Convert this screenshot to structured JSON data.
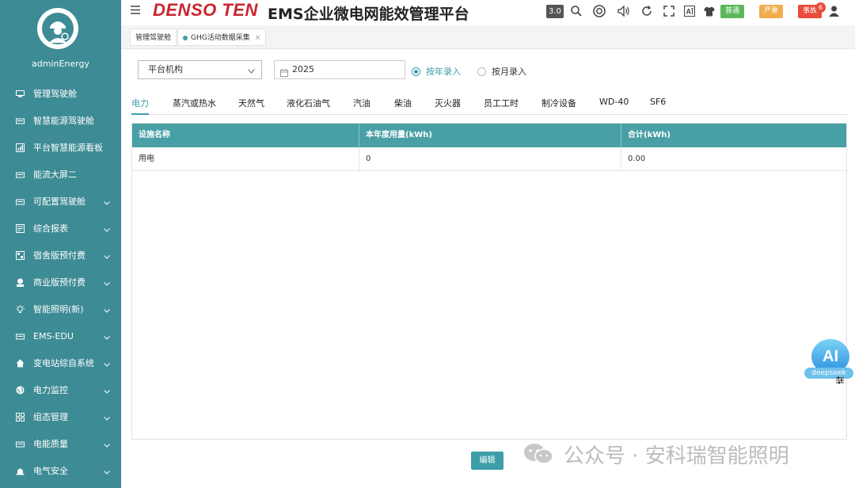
{
  "sidebar": {
    "username": "adminEnergy",
    "items": [
      {
        "label": "管理驾驶舱",
        "icon": "monitor-icon",
        "expandable": false
      },
      {
        "label": "智慧能源驾驶舱",
        "icon": "dashboard-icon",
        "expandable": false
      },
      {
        "label": "平台智慧能源看板",
        "icon": "chart-board-icon",
        "expandable": false
      },
      {
        "label": "能流大屏二",
        "icon": "screen-icon",
        "expandable": false
      },
      {
        "label": "可配置驾驶舱",
        "icon": "config-cockpit-icon",
        "expandable": true
      },
      {
        "label": "综合报表",
        "icon": "report-icon",
        "expandable": true
      },
      {
        "label": "宿舍版预付费",
        "icon": "dorm-icon",
        "expandable": true
      },
      {
        "label": "商业版预付费",
        "icon": "commerce-icon",
        "expandable": true
      },
      {
        "label": "智能照明(新)",
        "icon": "bulb-icon",
        "expandable": true
      },
      {
        "label": "EMS-EDU",
        "icon": "edu-icon",
        "expandable": true
      },
      {
        "label": "变电站综自系统",
        "icon": "home-icon",
        "expandable": true
      },
      {
        "label": "电力监控",
        "icon": "globe-icon",
        "expandable": true
      },
      {
        "label": "组态管理",
        "icon": "grid-icon",
        "expandable": true
      },
      {
        "label": "电能质量",
        "icon": "quality-icon",
        "expandable": true
      },
      {
        "label": "电气安全",
        "icon": "alarm-icon",
        "expandable": true
      }
    ]
  },
  "header": {
    "brand": "DENSO TEN",
    "title": "EMS企业微电网能效管理平台",
    "version": "3.0",
    "badges": [
      {
        "label": "普通",
        "color": "#5cb85c"
      },
      {
        "label": "严重",
        "color": "#f0ad4e"
      },
      {
        "label": "事故",
        "color": "#e74c3c",
        "count": "6"
      }
    ]
  },
  "tabs": {
    "home": "管理驾驶舱",
    "active": "GHG活动数据采集",
    "close": "×"
  },
  "filters": {
    "org_select": "平台机构",
    "year": "2025",
    "radio_year": "按年录入",
    "radio_month": "按月录入"
  },
  "categories": [
    "电力",
    "蒸汽或热水",
    "天然气",
    "液化石油气",
    "汽油",
    "柴油",
    "灭火器",
    "员工工时",
    "制冷设备",
    "WD-40",
    "SF6"
  ],
  "table": {
    "headers": [
      "设施名称",
      "本年度用量(kWh)",
      "合计(kWh)"
    ],
    "rows": [
      [
        "用电",
        "0",
        "0.00"
      ]
    ]
  },
  "edit_label": "编辑",
  "ai": {
    "label": "AI",
    "tag": "deepseek"
  },
  "watermark": "公众号 · 安科瑞智能照明",
  "colors": {
    "sidebar": "#3d8b95",
    "accent": "#3d9ea9",
    "brand": "#c8262f"
  }
}
